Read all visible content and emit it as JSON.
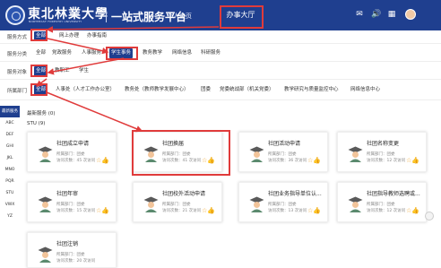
{
  "header": {
    "school_name": "東北林業大學",
    "school_en": "NORTHEAST FORESTRY UNIVERSITY",
    "platform": "一站式服务平台",
    "nav_home": "个人主页",
    "nav_hall": "办事大厅",
    "icons": [
      "message-icon",
      "volume-icon",
      "grid-icon",
      "avatar"
    ]
  },
  "filters": {
    "method": {
      "label": "服务方式",
      "items": [
        "全部",
        "网上办理",
        "办事指南"
      ]
    },
    "category": {
      "label": "服务分类",
      "items": [
        "全部",
        "党政服务",
        "人事服务",
        "学生事务",
        "教务教学",
        "网络信息",
        "科研服务"
      ]
    },
    "object": {
      "label": "服务对象",
      "items": [
        "全部",
        "教职工",
        "学生"
      ]
    },
    "dept": {
      "label": "所属部门",
      "items": [
        "全部",
        "人事处（人才工作办公室）",
        "教务处（教师教学发展中心）",
        "团委",
        "党委统战部（机关党委）",
        "教学研究与质量监控中心",
        "网络信息中心"
      ]
    }
  },
  "sidebar": {
    "items": [
      "最新服务",
      "ABC",
      "DEF",
      "GHI",
      "JKL",
      "MNO",
      "PQR",
      "STU",
      "VWX",
      "YZ"
    ]
  },
  "main": {
    "title": "最新服务 (0)",
    "subtitle": "STU (9)"
  },
  "cards": [
    {
      "title": "社团成立申请",
      "dept": "所属部门：团委",
      "visits": "访问次数：45 次访问"
    },
    {
      "title": "社团换届",
      "dept": "所属部门：团委",
      "visits": "访问次数：41 次访问"
    },
    {
      "title": "社团活动申请",
      "dept": "所属部门：团委",
      "visits": "访问次数：36 次访问"
    },
    {
      "title": "社团名称变更",
      "dept": "所属部门：团委",
      "visits": "访问次数：12 次访问"
    },
    {
      "title": "社团年审",
      "dept": "所属部门：团委",
      "visits": "访问次数：15 次访问"
    },
    {
      "title": "社团校外活动申请",
      "dept": "所属部门：团委",
      "visits": "访问次数：21 次访问"
    },
    {
      "title": "社团业务指导单位认...",
      "dept": "所属部门：团委",
      "visits": "访问次数：13 次访问"
    },
    {
      "title": "社团指导教师选聘或...",
      "dept": "所属部门：团委",
      "visits": "访问次数：12 次访问"
    },
    {
      "title": "社团注销",
      "dept": "所属部门：团委",
      "visits": "访问次数：20 次访问"
    }
  ],
  "colors": {
    "brand": "#1f3f8f",
    "highlight": "#e03b3b",
    "star": "#f0a020"
  }
}
